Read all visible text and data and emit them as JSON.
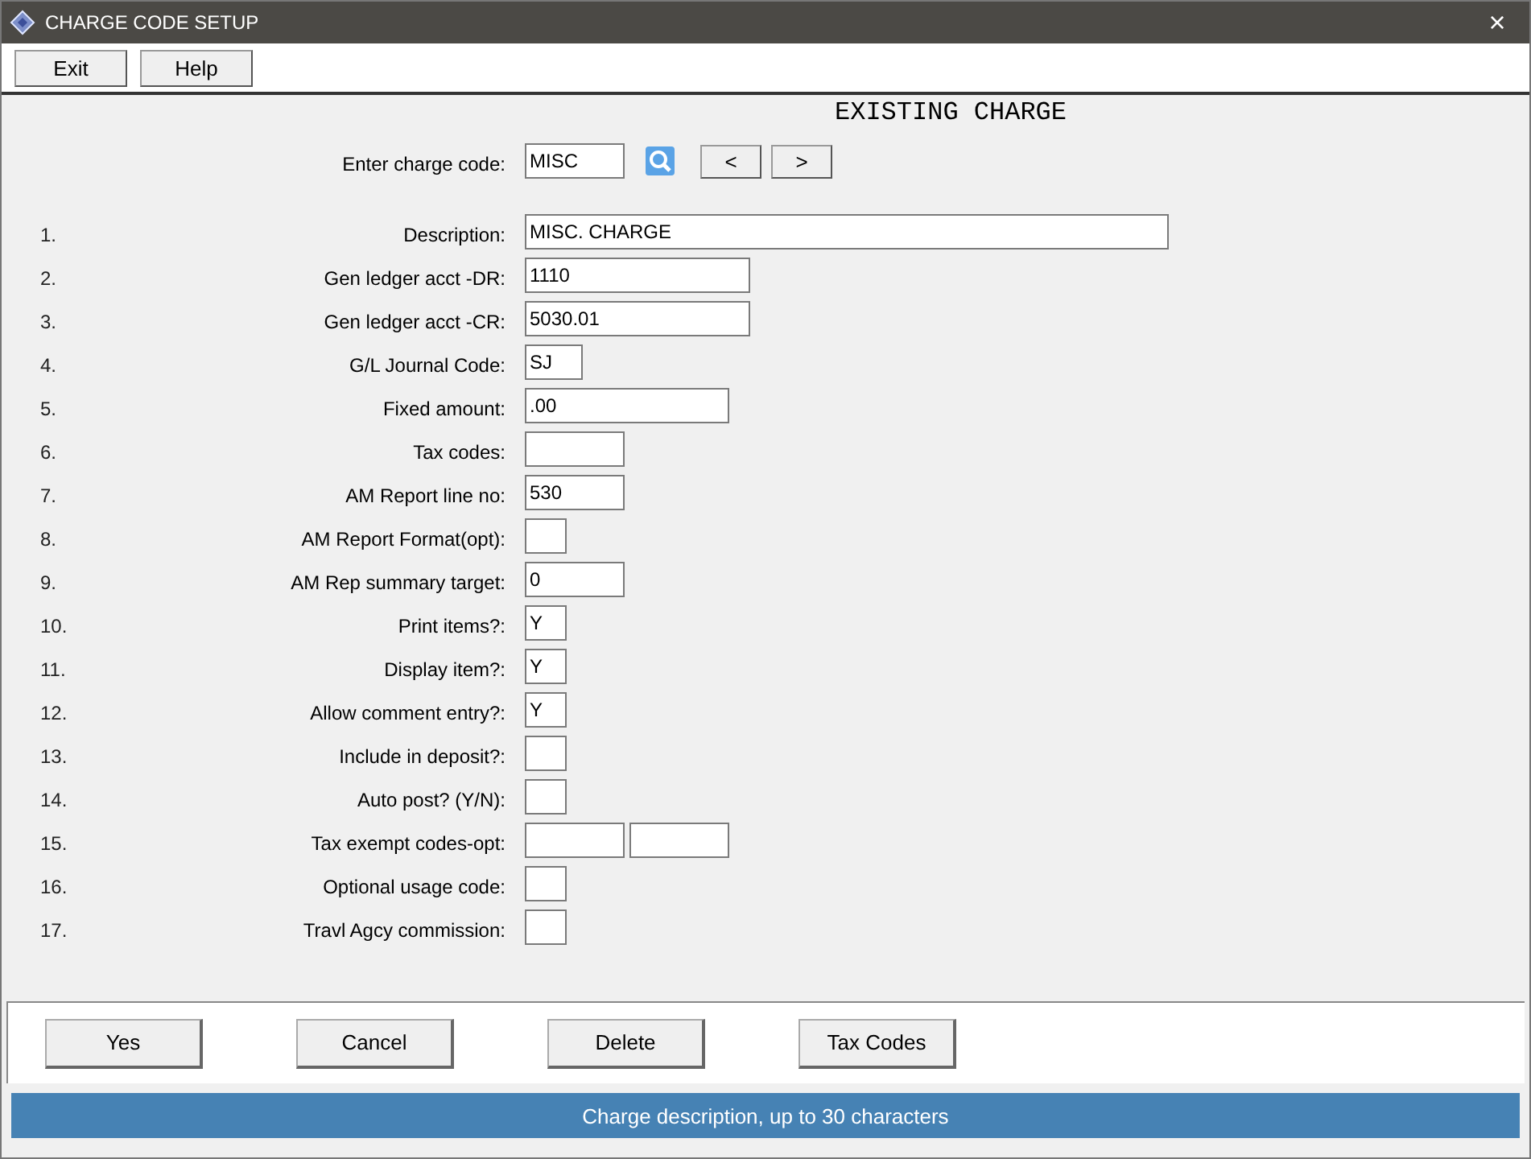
{
  "window": {
    "title": "CHARGE CODE SETUP",
    "close": "×"
  },
  "toolbar": [
    "Exit",
    "Help"
  ],
  "heading": "EXISTING CHARGE",
  "lookup": {
    "label": "Enter charge code:",
    "value": "MISC",
    "prev": "<",
    "next": ">"
  },
  "fields": [
    {
      "number": "1.",
      "label": "Description:",
      "kind": "wide",
      "value": "MISC. CHARGE"
    },
    {
      "number": "2.",
      "label": "Gen ledger acct -DR:",
      "kind": "account",
      "value": "1110"
    },
    {
      "number": "3.",
      "label": "Gen ledger acct -CR:",
      "kind": "account",
      "value": "5030.01"
    },
    {
      "number": "4.",
      "label": "G/L Journal Code:",
      "kind": "code",
      "value": "SJ"
    },
    {
      "number": "5.",
      "label": "Fixed amount:",
      "kind": "amount",
      "value": ".00"
    },
    {
      "number": "6.",
      "label": "Tax codes:",
      "kind": "short"
    },
    {
      "number": "7.",
      "label": "AM Report line no:",
      "kind": "short",
      "value": "530"
    },
    {
      "number": "8.",
      "label": "AM Report Format(opt):",
      "kind": "flag"
    },
    {
      "number": "9.",
      "label": "AM Rep summary target:",
      "kind": "short",
      "value": "0"
    },
    {
      "number": "10.",
      "label": "Print items?:",
      "kind": "flag",
      "value": "Y"
    },
    {
      "number": "11.",
      "label": "Display item?:",
      "kind": "flag",
      "value": "Y"
    },
    {
      "number": "12.",
      "label": "Allow comment entry?:",
      "kind": "flag",
      "value": "Y"
    },
    {
      "number": "13.",
      "label": "Include in deposit?:",
      "kind": "flag"
    },
    {
      "number": "14.",
      "label": "Auto post? (Y/N):",
      "kind": "flag"
    },
    {
      "number": "15.",
      "label": "Tax exempt codes-opt:",
      "kind": "pair"
    },
    {
      "number": "16.",
      "label": "Optional usage code:",
      "kind": "flag"
    },
    {
      "number": "17.",
      "label": "Travl Agcy commission:",
      "kind": "flag"
    }
  ],
  "buttons": [
    "Yes",
    "Cancel",
    "Delete",
    "Tax Codes"
  ],
  "status_bar": "Charge description, up to 30 characters"
}
